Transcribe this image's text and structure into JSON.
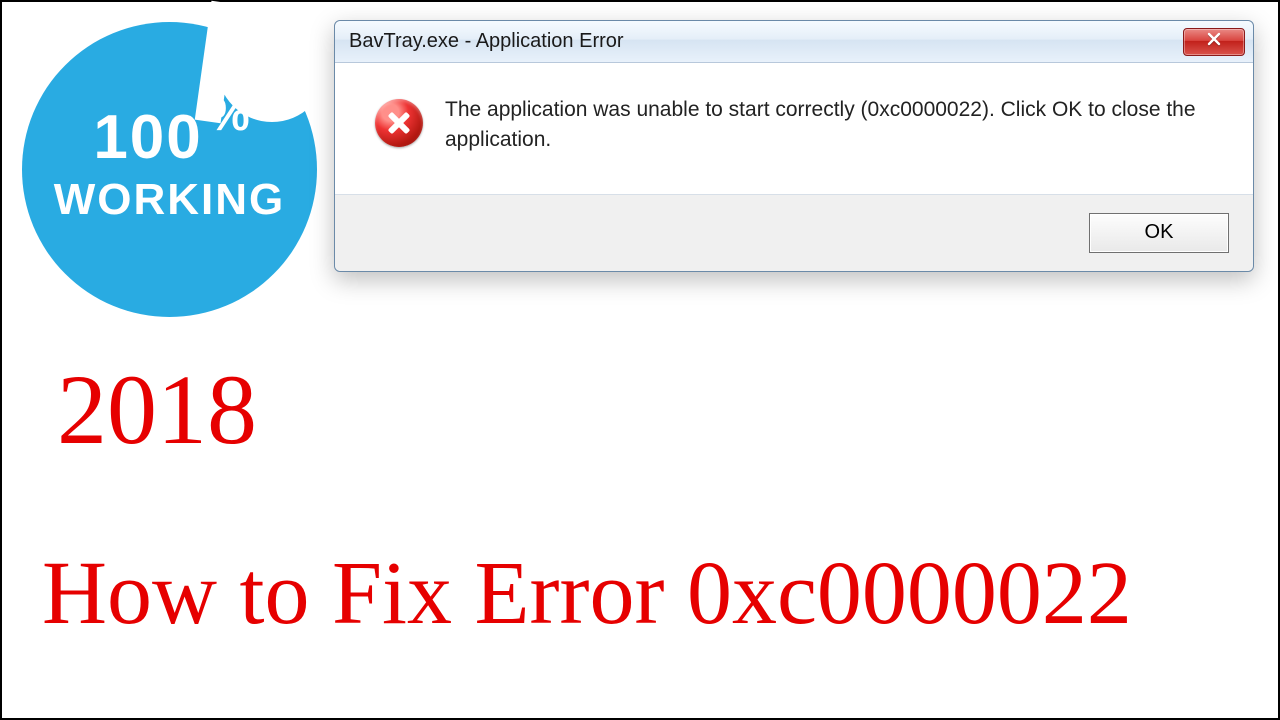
{
  "badge": {
    "line1_number": "100",
    "line1_percent": "%",
    "line2": "WORKING"
  },
  "dialog": {
    "title": "BavTray.exe - Application Error",
    "message": "The application was unable to start correctly (0xc0000022). Click OK to close the application.",
    "ok_label": "OK"
  },
  "overlay": {
    "year": "2018",
    "headline": "How to Fix Error 0xc0000022"
  }
}
